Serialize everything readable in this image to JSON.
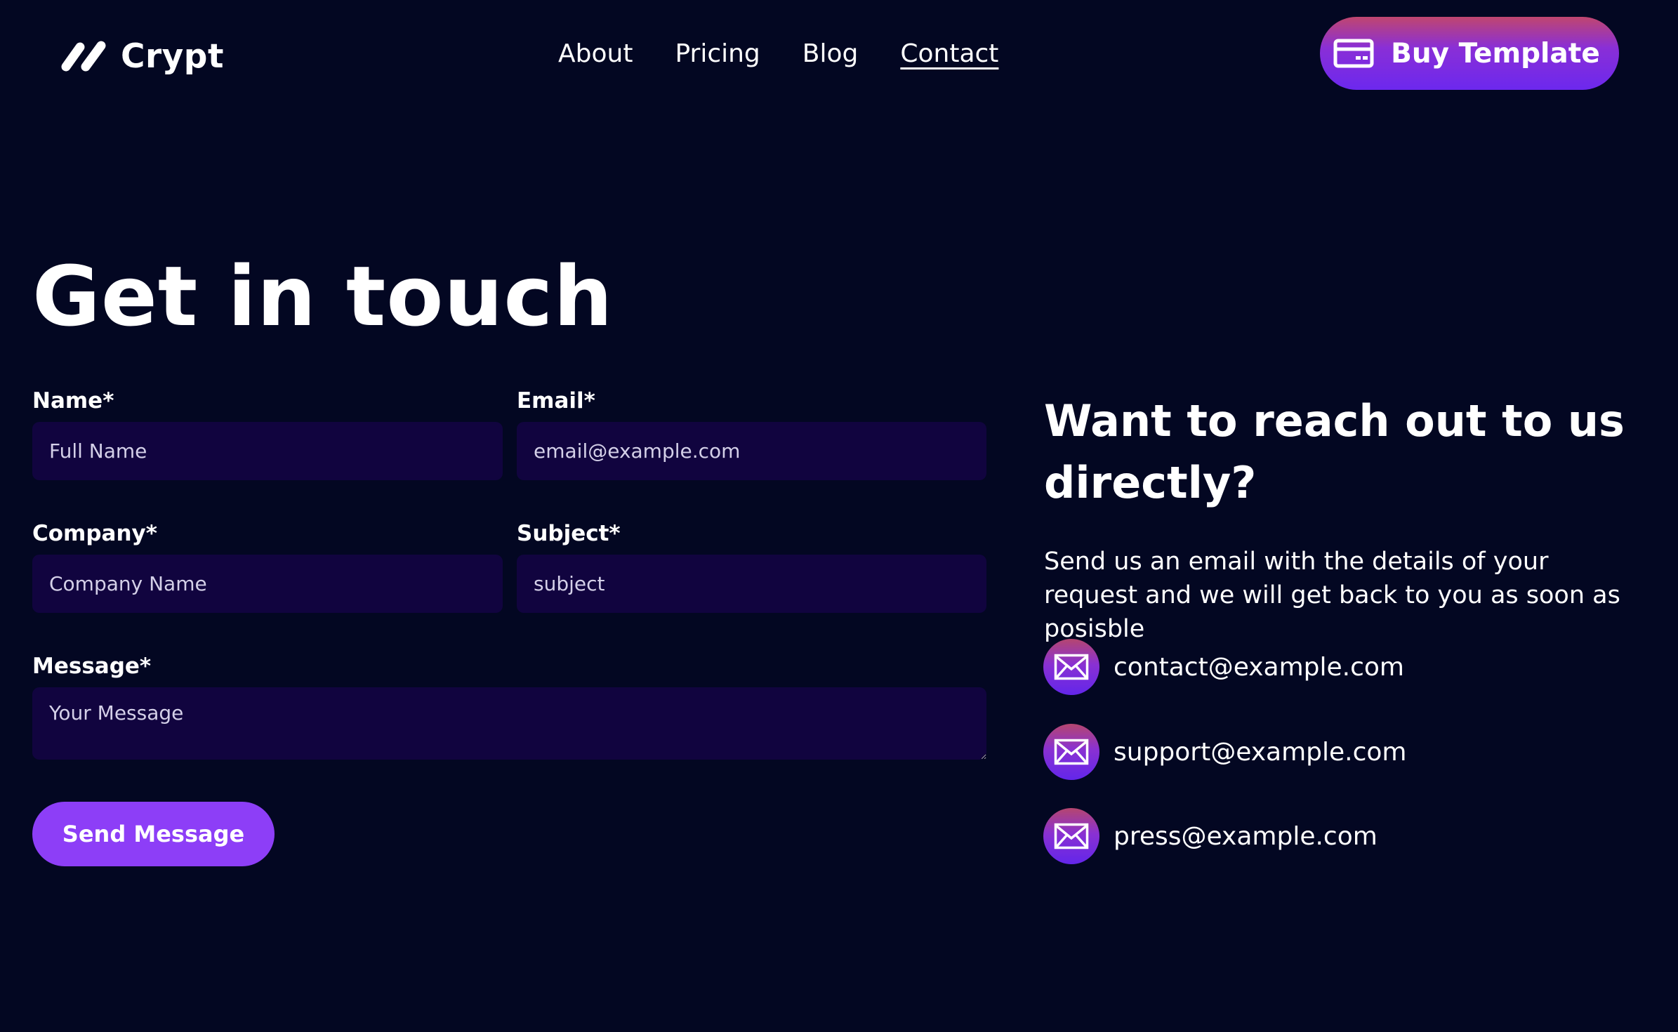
{
  "brand": {
    "name": "Crypt"
  },
  "nav": {
    "items": [
      {
        "label": "About"
      },
      {
        "label": "Pricing"
      },
      {
        "label": "Blog"
      },
      {
        "label": "Contact",
        "active": true
      }
    ]
  },
  "header": {
    "buy_button_label": "Buy Template",
    "buy_icon": "credit-card-icon"
  },
  "hero": {
    "title": "Get in touch"
  },
  "form": {
    "name": {
      "label": "Name*",
      "placeholder": "Full Name",
      "value": ""
    },
    "email": {
      "label": "Email*",
      "placeholder": "email@example.com",
      "value": ""
    },
    "company": {
      "label": "Company*",
      "placeholder": "Company Name",
      "value": ""
    },
    "subject": {
      "label": "Subject*",
      "placeholder": "subject",
      "value": ""
    },
    "message": {
      "label": "Message*",
      "placeholder": "Your Message",
      "value": ""
    },
    "submit_label": "Send Message"
  },
  "side": {
    "title": "Want to reach out to us directly?",
    "description": "Send us an email with the details of your request and we will get back to you as soon as posisble",
    "contacts": [
      {
        "email": "contact@example.com",
        "icon": "mail-icon"
      },
      {
        "email": "support@example.com",
        "icon": "mail-icon"
      },
      {
        "email": "press@example.com",
        "icon": "mail-icon"
      }
    ]
  },
  "colors": {
    "background": "#030722",
    "input_background": "#11043f",
    "accent": "#8d3ef7",
    "gradient_top": "#c0466f",
    "gradient_bottom": "#6c28ee"
  }
}
